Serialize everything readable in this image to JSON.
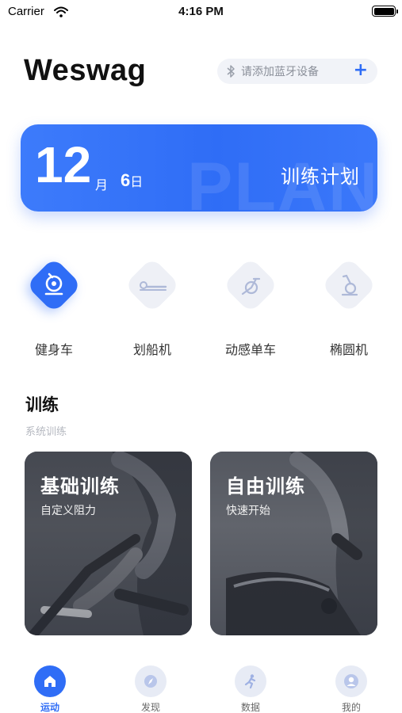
{
  "status_bar": {
    "carrier": "Carrier",
    "time": "4:16 PM",
    "battery_level": 1.0
  },
  "header": {
    "title": "Weswag",
    "bluetooth_button_label": "请添加蓝牙设备",
    "add_symbol": "+"
  },
  "plan_banner": {
    "day_number": "12",
    "month_unit": "月",
    "day": "6",
    "day_unit": "日",
    "label": "训练计划",
    "watermark": "PLAN"
  },
  "equipment": [
    {
      "label": "健身车",
      "icon": "spin-bike-icon",
      "active": true
    },
    {
      "label": "划船机",
      "icon": "rowing-machine-icon",
      "active": false
    },
    {
      "label": "动感单车",
      "icon": "exercise-bike-icon",
      "active": false
    },
    {
      "label": "椭圆机",
      "icon": "elliptical-icon",
      "active": false
    }
  ],
  "training_section": {
    "title": "训练",
    "subtitle": "系统训练",
    "cards": [
      {
        "title": "基础训练",
        "subtitle": "自定义阻力"
      },
      {
        "title": "自由训练",
        "subtitle": "快速开始"
      }
    ]
  },
  "tab_bar": [
    {
      "label": "运动",
      "icon": "home-icon",
      "active": true
    },
    {
      "label": "发现",
      "icon": "compass-icon",
      "active": false
    },
    {
      "label": "数据",
      "icon": "runner-icon",
      "active": false
    },
    {
      "label": "我的",
      "icon": "user-icon",
      "active": false
    }
  ],
  "colors": {
    "accent": "#2f6df6",
    "inactive_bg": "#eef0f6",
    "muted_text": "#b5b8c0"
  }
}
